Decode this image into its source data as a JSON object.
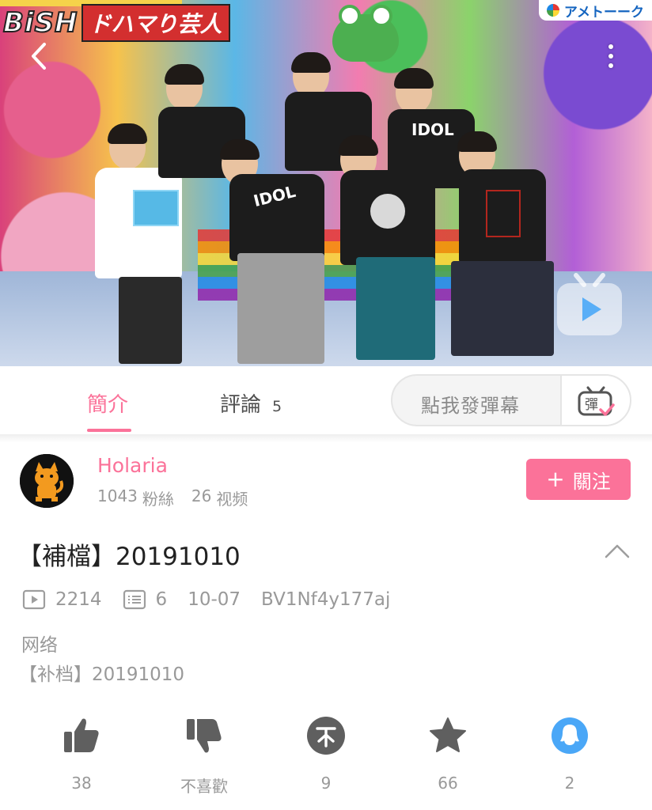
{
  "video": {
    "overlay_title_en": "BiSH",
    "overlay_title_jp": "ドハマり芸人",
    "overlay_top_right": "アメトーーク",
    "shirt_text_center": "IDOL",
    "shirt_text_right": "IDOL"
  },
  "tabs": {
    "intro_label": "簡介",
    "comments_label": "評論",
    "comments_count": "5"
  },
  "danmaku": {
    "placeholder": "點我發彈幕",
    "toggle_label": "彈"
  },
  "uploader": {
    "name": "Holaria",
    "fans_count": "1043",
    "fans_label": "粉絲",
    "videos_count": "26",
    "videos_label": "视频",
    "follow_label": "關注"
  },
  "details": {
    "title": "【補檔】20191010",
    "play_count": "2214",
    "danmaku_count": "6",
    "date": "10-07",
    "bvid": "BV1Nf4y177aj",
    "category": "网络",
    "description": "【补档】20191010"
  },
  "actions": {
    "like": "38",
    "dislike": "不喜歡",
    "coin": "9",
    "favorite": "66",
    "share": "2"
  },
  "colors": {
    "accent": "#fb7299",
    "secondary_text": "#999999",
    "icon_gray": "#5f5f5f",
    "share_blue": "#4aa7f7"
  }
}
